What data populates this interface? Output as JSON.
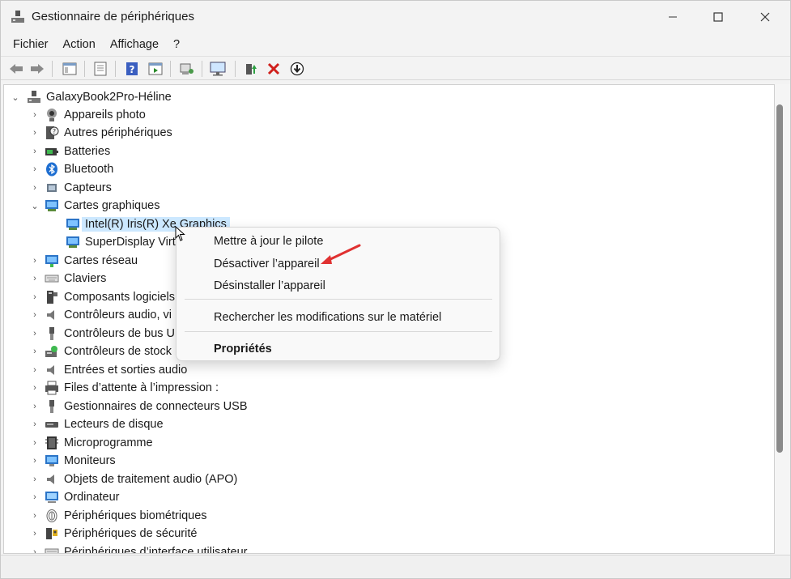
{
  "window": {
    "title": "Gestionnaire de périphériques",
    "controls": {
      "minimize": "minimize-icon",
      "maximize": "maximize-icon",
      "close": "close-icon"
    }
  },
  "menu": [
    "Fichier",
    "Action",
    "Affichage",
    "?"
  ],
  "toolbar": [
    "back-arrow-icon",
    "forward-arrow-icon",
    "console-tree-icon",
    "properties-icon",
    "help-icon",
    "action-pane-icon",
    "scan-hardware-icon",
    "monitor-network-icon",
    "update-driver-icon",
    "uninstall-icon",
    "disable-icon"
  ],
  "tree": {
    "root": "GalaxyBook2Pro-Héline",
    "nodes": [
      {
        "label": "Appareils photo",
        "icon": "camera-icon",
        "expanded": false
      },
      {
        "label": "Autres périphériques",
        "icon": "unknown-device-icon",
        "expanded": false
      },
      {
        "label": "Batteries",
        "icon": "battery-icon",
        "expanded": false
      },
      {
        "label": "Bluetooth",
        "icon": "bluetooth-icon",
        "expanded": false
      },
      {
        "label": "Capteurs",
        "icon": "sensor-icon",
        "expanded": false
      },
      {
        "label": "Cartes graphiques",
        "icon": "display-adapter-icon",
        "expanded": true,
        "children": [
          {
            "label": "Intel(R) Iris(R) Xe Graphics",
            "icon": "display-adapter-icon",
            "selected": true
          },
          {
            "label": "SuperDisplay Virt",
            "icon": "display-adapter-icon",
            "selected": false
          }
        ]
      },
      {
        "label": "Cartes réseau",
        "icon": "network-adapter-icon",
        "expanded": false
      },
      {
        "label": "Claviers",
        "icon": "keyboard-icon",
        "expanded": false
      },
      {
        "label": "Composants logiciels",
        "icon": "software-component-icon",
        "expanded": false
      },
      {
        "label": "Contrôleurs audio, vi",
        "icon": "speaker-icon",
        "expanded": false
      },
      {
        "label": "Contrôleurs de bus U",
        "icon": "usb-icon",
        "expanded": false
      },
      {
        "label": "Contrôleurs de stock",
        "icon": "storage-controller-icon",
        "expanded": false
      },
      {
        "label": "Entrées et sorties audio",
        "icon": "speaker-icon",
        "expanded": false
      },
      {
        "label": "Files d’attente à l’impression :",
        "icon": "printer-icon",
        "expanded": false
      },
      {
        "label": "Gestionnaires de connecteurs USB",
        "icon": "usb-icon",
        "expanded": false
      },
      {
        "label": "Lecteurs de disque",
        "icon": "disk-drive-icon",
        "expanded": false
      },
      {
        "label": "Microprogramme",
        "icon": "firmware-icon",
        "expanded": false
      },
      {
        "label": "Moniteurs",
        "icon": "monitor-icon",
        "expanded": false
      },
      {
        "label": "Objets de traitement audio (APO)",
        "icon": "speaker-icon",
        "expanded": false
      },
      {
        "label": "Ordinateur",
        "icon": "computer-icon",
        "expanded": false
      },
      {
        "label": "Périphériques biométriques",
        "icon": "fingerprint-icon",
        "expanded": false
      },
      {
        "label": "Périphériques de sécurité",
        "icon": "security-icon",
        "expanded": false
      },
      {
        "label": "Périphériques d’interface utilisateur",
        "icon": "hid-icon",
        "expanded": false
      }
    ]
  },
  "context_menu": {
    "items": [
      {
        "label": "Mettre à jour le pilote"
      },
      {
        "label": "Désactiver l’appareil",
        "highlighted_by_arrow": true
      },
      {
        "label": "Désinstaller l’appareil"
      },
      {
        "label": "Rechercher les modifications sur le matériel"
      },
      {
        "label": "Propriétés",
        "bold": true
      }
    ]
  },
  "colors": {
    "selection": "#cce8ff",
    "annotation_arrow": "#e03131",
    "window_bg": "#f3f3f3"
  }
}
